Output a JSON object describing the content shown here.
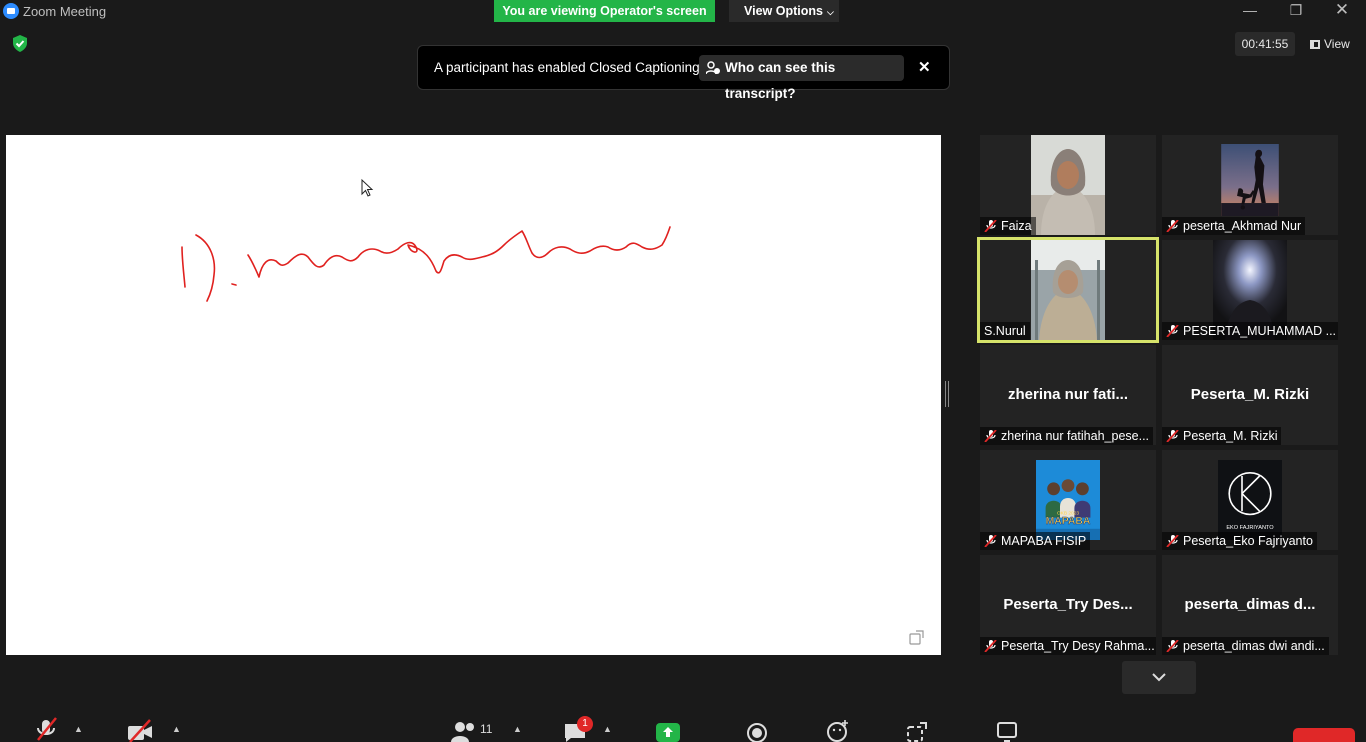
{
  "window": {
    "title": "Zoom Meeting",
    "banner": "You are viewing Operator's screen",
    "view_options": "View Options"
  },
  "top": {
    "timer": "00:41:55",
    "view_label": "View"
  },
  "notice": {
    "text": "A participant has enabled Closed Captioning",
    "who_label": "Who can see this transcript?"
  },
  "participants": [
    {
      "label": "Faiza",
      "muted": true,
      "active": false,
      "video": true,
      "big_name": ""
    },
    {
      "label": "peserta_Akhmad Nur",
      "muted": true,
      "active": false,
      "video": true,
      "big_name": ""
    },
    {
      "label": "S.Nurul",
      "muted": false,
      "active": true,
      "video": true,
      "big_name": ""
    },
    {
      "label": "PESERTA_MUHAMMAD ...",
      "muted": true,
      "active": false,
      "video": true,
      "big_name": ""
    },
    {
      "label": "zherina nur fatihah_pese...",
      "muted": true,
      "active": false,
      "video": false,
      "big_name": "zherina nur fati..."
    },
    {
      "label": "Peserta_M. Rizki",
      "muted": true,
      "active": false,
      "video": false,
      "big_name": "Peserta_M. Rizki"
    },
    {
      "label": "MAPABA FISIP",
      "muted": true,
      "active": false,
      "video": true,
      "big_name": ""
    },
    {
      "label": "Peserta_Eko Fajriyanto",
      "muted": true,
      "active": false,
      "video": true,
      "big_name": ""
    },
    {
      "label": "Peserta_Try Desy Rahma...",
      "muted": true,
      "active": false,
      "video": false,
      "big_name": "Peserta_Try Des..."
    },
    {
      "label": "peserta_dimas dwi andi...",
      "muted": true,
      "active": false,
      "video": false,
      "big_name": "peserta_dimas d..."
    }
  ],
  "logo_text": {
    "mapaba": "MAPABA",
    "mapaba_small": "OKB 2023",
    "eko": "EKO FAJRIYANTO"
  },
  "toolbar": {
    "participants_count": "11",
    "chat_badge": "1"
  },
  "colors": {
    "banner_green": "#23b548",
    "active_border": "#d6e36a",
    "mute_red": "#e02828",
    "ink_red": "#e0211f"
  }
}
